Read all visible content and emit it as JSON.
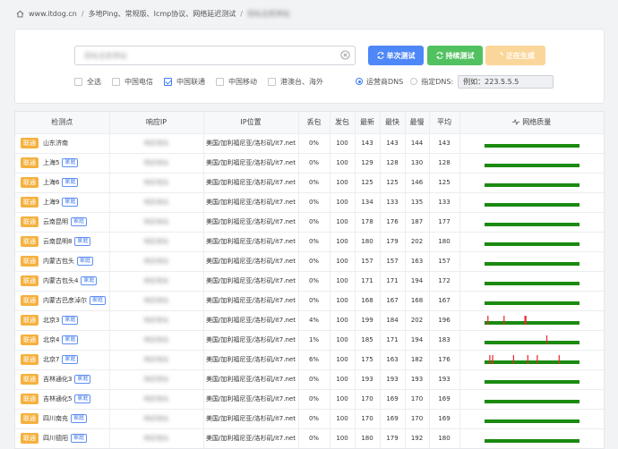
{
  "breadcrumb": {
    "site": "www.itdog.cn",
    "section": "多地Ping、常规版、Icmp协议、网络延迟测试",
    "target": "目标主机地址"
  },
  "search": {
    "value": "目标主机地址"
  },
  "buttons": {
    "once": "单次测试",
    "continuous": "持续测试",
    "generating": "正在生成"
  },
  "filters": [
    {
      "label": "全选",
      "checked": false
    },
    {
      "label": "中国电信",
      "checked": false
    },
    {
      "label": "中国联通",
      "checked": true
    },
    {
      "label": "中国移动",
      "checked": false
    },
    {
      "label": "港澳台、海外",
      "checked": false
    }
  ],
  "dns": {
    "operator_label": "运营商DNS",
    "custom_label": "指定DNS:",
    "operator_selected": true,
    "custom_value": "例如：223.5.5.5"
  },
  "table": {
    "headers": [
      "检测点",
      "响应IP",
      "IP位置",
      "丢包",
      "发包",
      "最新",
      "最快",
      "最慢",
      "平均",
      "网络质量"
    ],
    "rows": [
      {
        "isp": "联通",
        "city": "山东济南",
        "home": false,
        "ip": "响应地址",
        "loc": "美国/加利福尼亚/洛杉矶/it7.net",
        "loss": "0%",
        "sent": "100",
        "latest": "143",
        "fast": "143",
        "slow": "144",
        "avg": "143",
        "spikes": []
      },
      {
        "isp": "联通",
        "city": "上海5",
        "home": true,
        "ip": "响应地址",
        "loc": "美国/加利福尼亚/洛杉矶/it7.net",
        "loss": "0%",
        "sent": "100",
        "latest": "129",
        "fast": "128",
        "slow": "130",
        "avg": "128",
        "spikes": []
      },
      {
        "isp": "联通",
        "city": "上海6",
        "home": true,
        "ip": "响应地址",
        "loc": "美国/加利福尼亚/洛杉矶/it7.net",
        "loss": "0%",
        "sent": "100",
        "latest": "125",
        "fast": "125",
        "slow": "146",
        "avg": "125",
        "spikes": []
      },
      {
        "isp": "联通",
        "city": "上海9",
        "home": true,
        "ip": "响应地址",
        "loc": "美国/加利福尼亚/洛杉矶/it7.net",
        "loss": "0%",
        "sent": "100",
        "latest": "134",
        "fast": "133",
        "slow": "135",
        "avg": "133",
        "spikes": []
      },
      {
        "isp": "联通",
        "city": "云南昆明",
        "home": true,
        "ip": "响应地址",
        "loc": "美国/加利福尼亚/洛杉矶/it7.net",
        "loss": "0%",
        "sent": "100",
        "latest": "178",
        "fast": "176",
        "slow": "187",
        "avg": "177",
        "spikes": []
      },
      {
        "isp": "联通",
        "city": "云南昆明8",
        "home": true,
        "ip": "响应地址",
        "loc": "美国/加利福尼亚/洛杉矶/it7.net",
        "loss": "0%",
        "sent": "100",
        "latest": "180",
        "fast": "179",
        "slow": "202",
        "avg": "180",
        "spikes": []
      },
      {
        "isp": "联通",
        "city": "内蒙古包头",
        "home": true,
        "ip": "响应地址",
        "loc": "美国/加利福尼亚/洛杉矶/it7.net",
        "loss": "0%",
        "sent": "100",
        "latest": "157",
        "fast": "157",
        "slow": "163",
        "avg": "157",
        "spikes": []
      },
      {
        "isp": "联通",
        "city": "内蒙古包头4",
        "home": true,
        "ip": "响应地址",
        "loc": "美国/加利福尼亚/洛杉矶/it7.net",
        "loss": "0%",
        "sent": "100",
        "latest": "171",
        "fast": "171",
        "slow": "194",
        "avg": "172",
        "spikes": []
      },
      {
        "isp": "联通",
        "city": "内蒙古巴彦淖尔",
        "home": true,
        "ip": "响应地址",
        "loc": "美国/加利福尼亚/洛杉矶/it7.net",
        "loss": "0%",
        "sent": "100",
        "latest": "168",
        "fast": "167",
        "slow": "168",
        "avg": "167",
        "spikes": []
      },
      {
        "isp": "联通",
        "city": "北京3",
        "home": true,
        "ip": "响应地址",
        "loc": "美国/加利福尼亚/洛杉矶/it7.net",
        "loss": "4%",
        "sent": "100",
        "latest": "199",
        "fast": "184",
        "slow": "202",
        "avg": "196",
        "spikes": [
          3,
          20,
          42,
          43
        ]
      },
      {
        "isp": "联通",
        "city": "北京4",
        "home": true,
        "ip": "响应地址",
        "loc": "美国/加利福尼亚/洛杉矶/it7.net",
        "loss": "1%",
        "sent": "100",
        "latest": "185",
        "fast": "171",
        "slow": "194",
        "avg": "183",
        "spikes": [
          65
        ]
      },
      {
        "isp": "联通",
        "city": "北京7",
        "home": true,
        "ip": "响应地址",
        "loc": "美国/加利福尼亚/洛杉矶/it7.net",
        "loss": "6%",
        "sent": "100",
        "latest": "175",
        "fast": "163",
        "slow": "182",
        "avg": "176",
        "spikes": [
          5,
          8,
          30,
          45,
          55,
          78
        ]
      },
      {
        "isp": "联通",
        "city": "吉林通化3",
        "home": true,
        "ip": "响应地址",
        "loc": "美国/加利福尼亚/洛杉矶/it7.net",
        "loss": "0%",
        "sent": "100",
        "latest": "193",
        "fast": "193",
        "slow": "193",
        "avg": "193",
        "spikes": []
      },
      {
        "isp": "联通",
        "city": "吉林通化5",
        "home": true,
        "ip": "响应地址",
        "loc": "美国/加利福尼亚/洛杉矶/it7.net",
        "loss": "0%",
        "sent": "100",
        "latest": "170",
        "fast": "169",
        "slow": "170",
        "avg": "169",
        "spikes": []
      },
      {
        "isp": "联通",
        "city": "四川南充",
        "home": true,
        "ip": "响应地址",
        "loc": "美国/加利福尼亚/洛杉矶/it7.net",
        "loss": "0%",
        "sent": "100",
        "latest": "170",
        "fast": "169",
        "slow": "170",
        "avg": "169",
        "spikes": []
      },
      {
        "isp": "联通",
        "city": "四川德阳",
        "home": true,
        "ip": "响应地址",
        "loc": "美国/加利福尼亚/洛杉矶/it7.net",
        "loss": "0%",
        "sent": "100",
        "latest": "180",
        "fast": "179",
        "slow": "192",
        "avg": "180",
        "spikes": []
      }
    ]
  },
  "colors": {
    "good": "#1a8a10",
    "loss": "#e8262b",
    "accent": "#4e87f7"
  }
}
